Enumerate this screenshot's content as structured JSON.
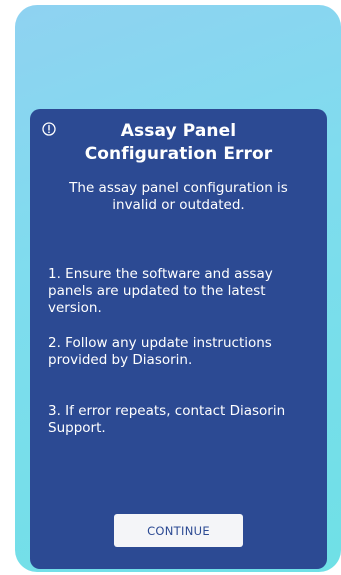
{
  "dialog": {
    "icon": "info-circle-icon",
    "title": "Assay Panel Configuration Error",
    "message": "The assay panel configuration is invalid or outdated.",
    "steps": [
      "1. Ensure the software and assay panels are updated to the latest version.",
      "2. Follow any update instructions provided by Diasorin.",
      "3. If error repeats, contact Diasorin Support."
    ],
    "continue_label": "CONTINUE"
  },
  "colors": {
    "dialog_background": "#2c4a93",
    "button_background": "#f4f5f8",
    "gradient_top": "#8fd2f1",
    "gradient_bottom": "#6fe0e6"
  }
}
